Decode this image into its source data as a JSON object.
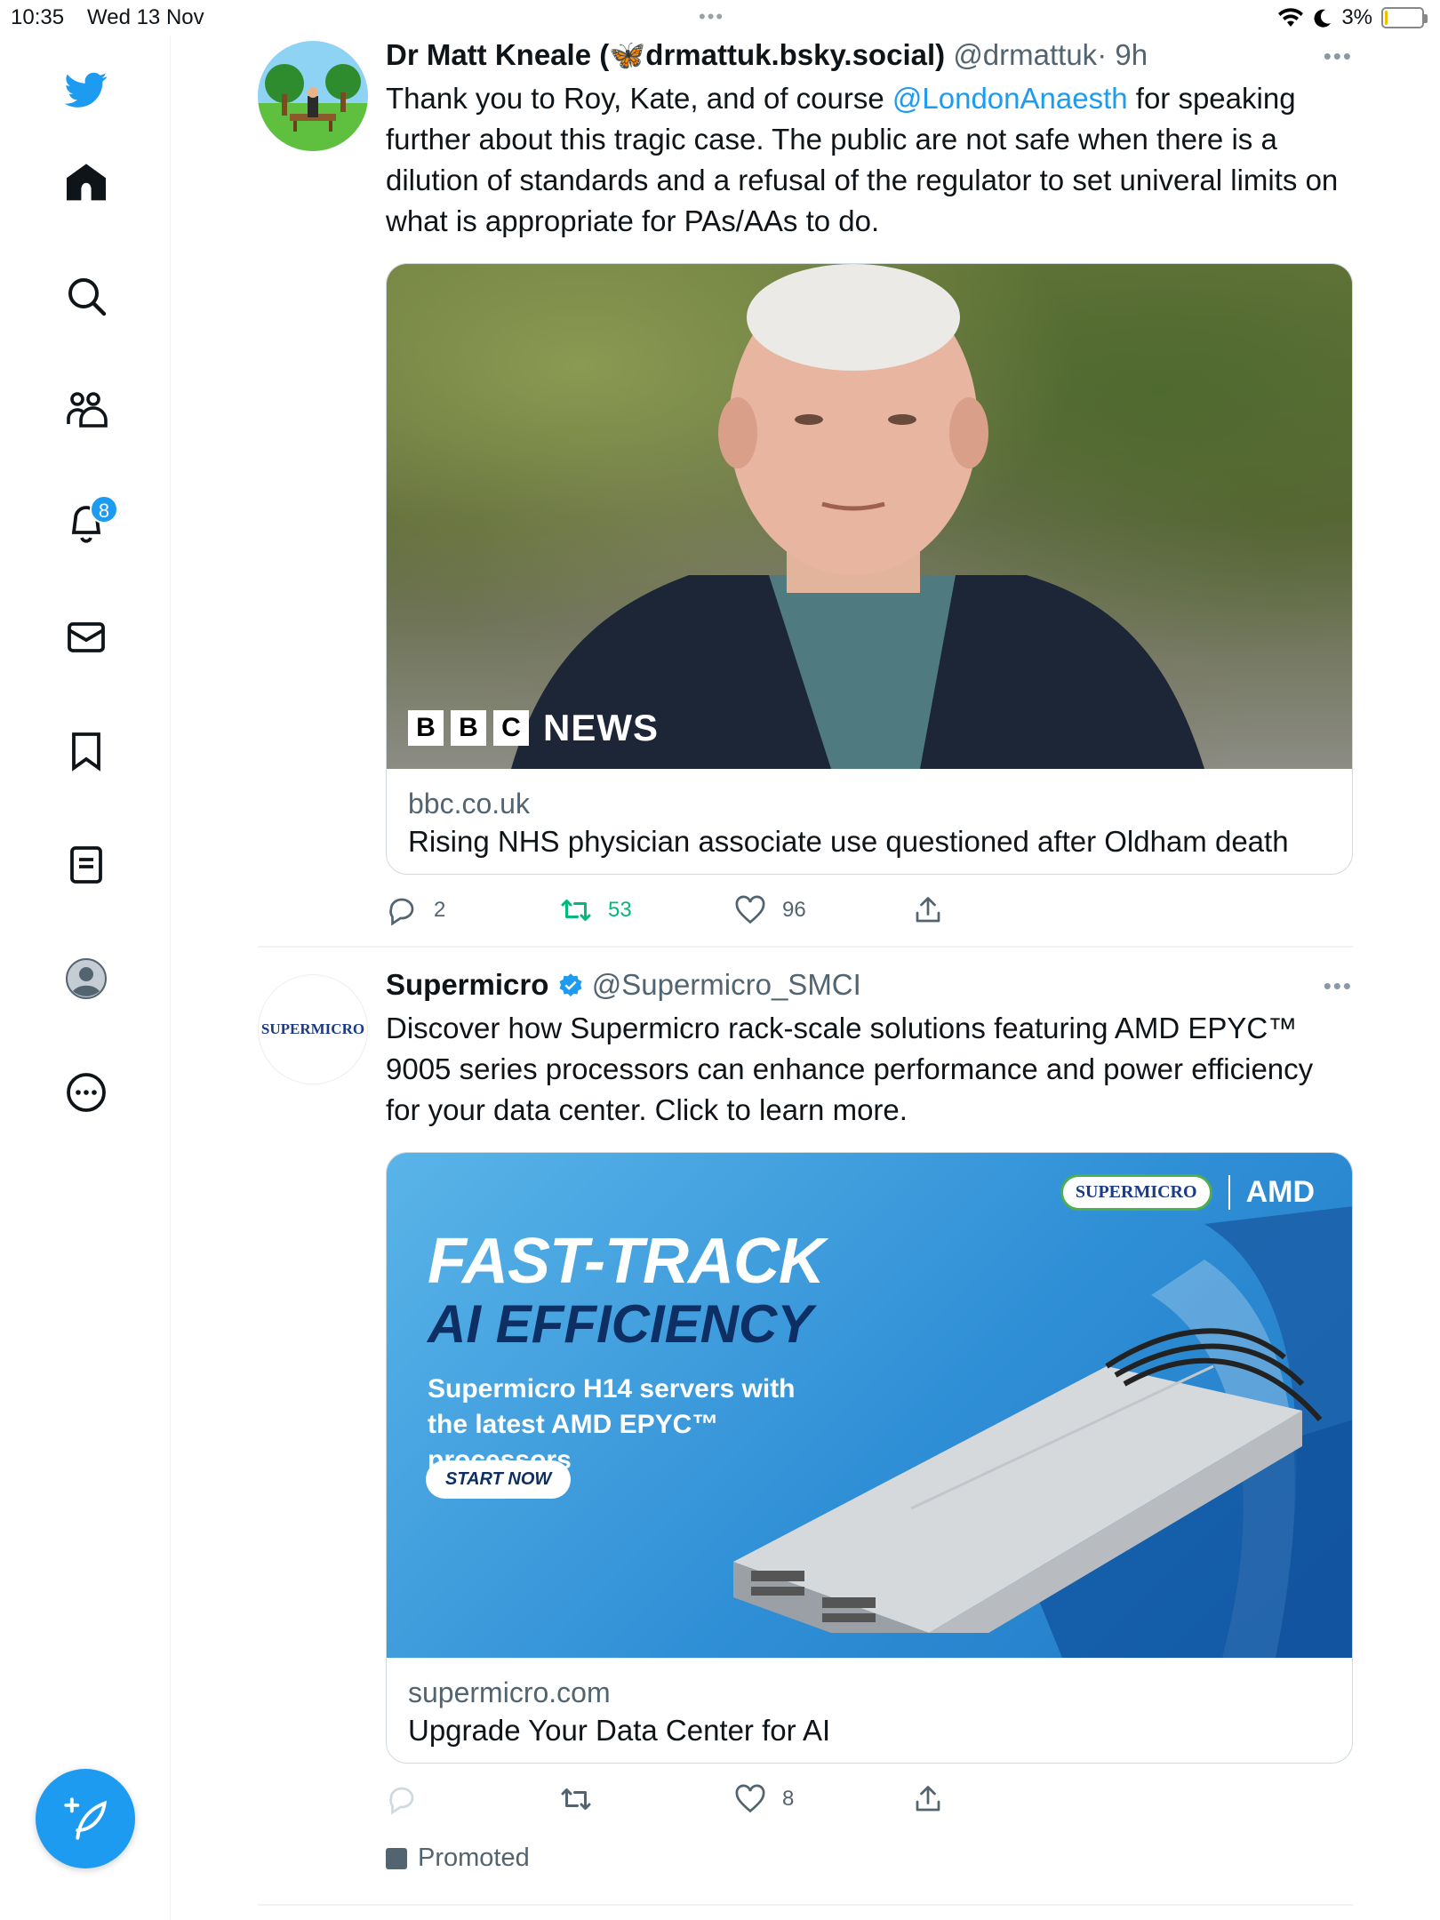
{
  "status_bar": {
    "time": "10:35",
    "date": "Wed 13 Nov",
    "battery": "3%"
  },
  "sidebar": {
    "notifications_badge": "8",
    "items": [
      {
        "icon": "twitter-bird-icon"
      },
      {
        "icon": "home-icon"
      },
      {
        "icon": "search-icon"
      },
      {
        "icon": "communities-icon"
      },
      {
        "icon": "notifications-bell-icon"
      },
      {
        "icon": "messages-icon"
      },
      {
        "icon": "bookmark-icon"
      },
      {
        "icon": "lists-icon"
      },
      {
        "icon": "profile-icon"
      },
      {
        "icon": "more-icon"
      }
    ]
  },
  "tweets": [
    {
      "name": "Dr Matt Kneale (🦋drmattuk.bsky.social)",
      "handle": "@drmattuk",
      "time": "· 9h",
      "text_before": "Thank you to Roy, Kate, and of course ",
      "mention": "@LondonAnaesth",
      "text_after": " for speaking further about this tragic case. The public are not safe when there is a dilution of standards and a refusal of the regulator to set univeral limits on what is appropriate for PAs/AAs to do.",
      "card": {
        "logo_letters": [
          "B",
          "B",
          "C"
        ],
        "logo_word": "NEWS",
        "domain": "bbc.co.uk",
        "title": "Rising NHS physician associate use questioned after Oldham death"
      },
      "replies": "2",
      "retweets": "53",
      "likes": "96"
    },
    {
      "name": "Supermicro",
      "handle": "@Supermicro_SMCI",
      "avatar_text": "SUPERMICRO",
      "text": "Discover how Supermicro rack-scale solutions featuring AMD EPYC™ 9005 series processors can enhance performance and power efficiency for your data center. Click to learn more.",
      "card": {
        "ad_logo_supermicro": "SUPERMICRO",
        "ad_logo_amd": "AMD",
        "headline_1": "FAST-TRACK",
        "headline_2": "AI EFFICIENCY",
        "subheadline": "Supermicro H14 servers with the latest AMD EPYC™ processors",
        "button": "START NOW",
        "domain": "supermicro.com",
        "title": "Upgrade Your Data Center for AI"
      },
      "replies": "",
      "retweets": "",
      "likes": "8",
      "promoted_label": "Promoted"
    }
  ],
  "colors": {
    "accent": "#1d9bf0",
    "retweet_green": "#00ba7c",
    "muted": "#536471"
  }
}
